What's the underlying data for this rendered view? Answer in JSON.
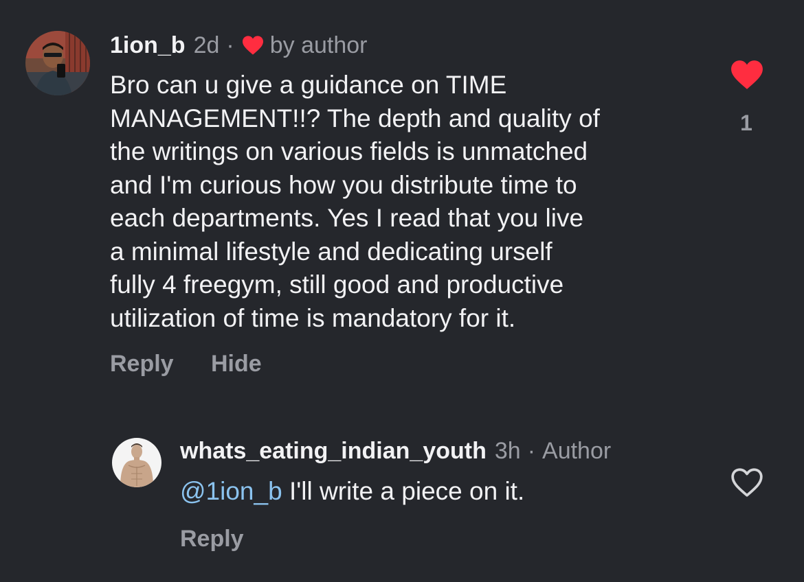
{
  "comment": {
    "username": "1ion_b",
    "time": "2d",
    "separator": "·",
    "by_author": "by author",
    "lines": [
      "Bro can u give a guidance on TIME",
      "MANAGEMENT!!? The depth and quality of",
      "the writings on various fields is unmatched",
      "and I'm curious how you distribute time to",
      "each departments. Yes I read that you live",
      "a minimal lifestyle and dedicating urself",
      "fully 4 freegym, still good and productive",
      "utilization of time is mandatory for it."
    ],
    "reply_label": "Reply",
    "hide_label": "Hide",
    "like_count": "1",
    "liked": true
  },
  "reply": {
    "username": "whats_eating_indian_youth",
    "time": "3h",
    "separator": "·",
    "badge": "Author",
    "mention": "@1ion_b",
    "text": " I'll write a piece on it.",
    "reply_label": "Reply",
    "liked": false
  },
  "colors": {
    "background": "#25272c",
    "text": "#f2f2f4",
    "muted": "#9a9ca3",
    "like_red": "#ff2d40",
    "mention": "#8bc3ef"
  },
  "icons": {
    "liked": "heart-filled-icon",
    "unliked": "heart-outline-icon",
    "author_liked": "small-heart-icon"
  }
}
